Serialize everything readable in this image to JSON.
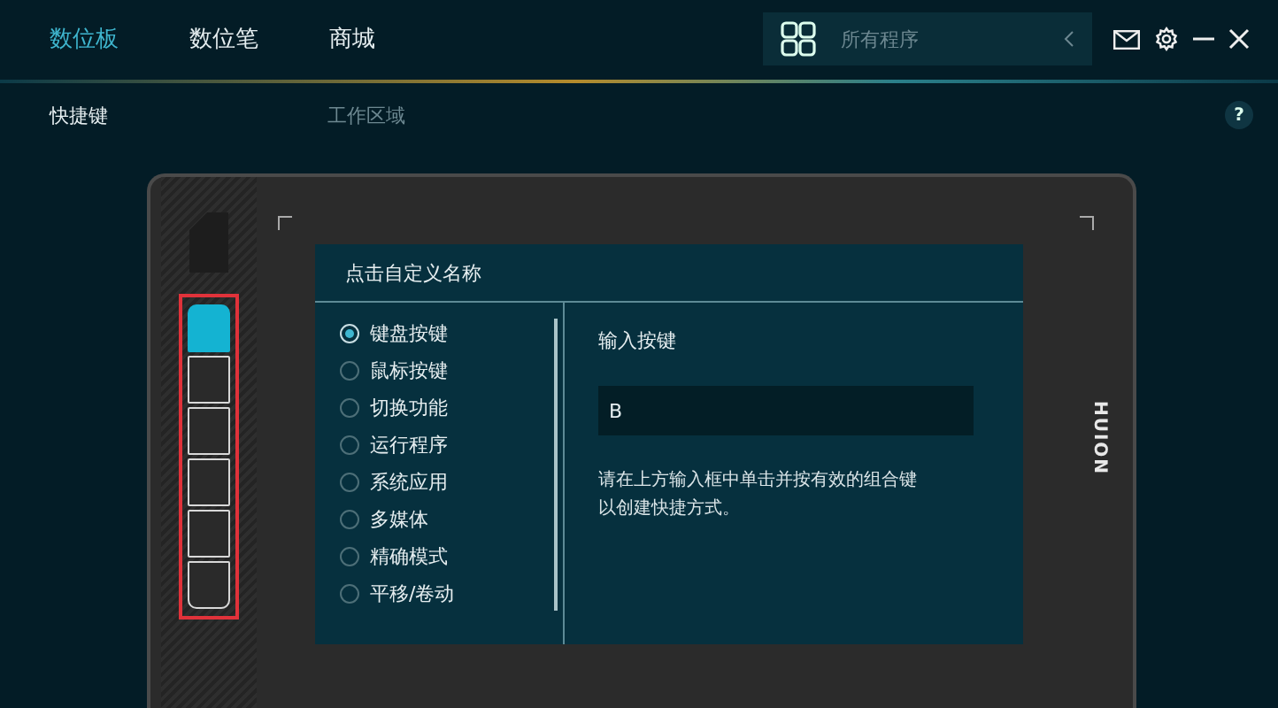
{
  "tabs": [
    {
      "label": "数位板",
      "selected": true
    },
    {
      "label": "数位笔",
      "selected": false
    },
    {
      "label": "商城",
      "selected": false
    }
  ],
  "search": {
    "placeholder": "所有程序"
  },
  "sub_tabs": [
    {
      "label": "快捷键",
      "selected": true
    },
    {
      "label": "工作区域",
      "selected": false
    }
  ],
  "help": "?",
  "express_keys": [
    {
      "selected": true
    },
    {
      "selected": false
    },
    {
      "selected": false
    },
    {
      "selected": false
    },
    {
      "selected": false
    },
    {
      "selected": false
    }
  ],
  "brand": "HUION",
  "dialog": {
    "title": "点击自定义名称",
    "options": [
      {
        "label": "键盘按键",
        "selected": true
      },
      {
        "label": "鼠标按键",
        "selected": false
      },
      {
        "label": "切换功能",
        "selected": false
      },
      {
        "label": "运行程序",
        "selected": false
      },
      {
        "label": "系统应用",
        "selected": false
      },
      {
        "label": "多媒体",
        "selected": false
      },
      {
        "label": "精确模式",
        "selected": false
      },
      {
        "label": "平移/卷动",
        "selected": false
      }
    ],
    "input_label": "输入按键",
    "input_value": "B",
    "hint": "请在上方输入框中单击并按有效的组合键以创建快捷方式。"
  }
}
